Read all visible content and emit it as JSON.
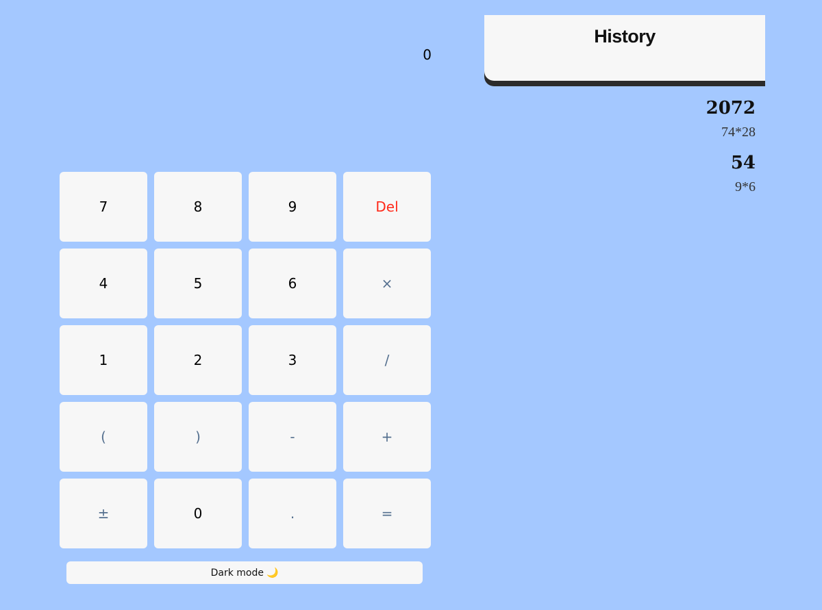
{
  "display": {
    "value": "0"
  },
  "keypad": {
    "keys": [
      {
        "label": "7",
        "role": "digit"
      },
      {
        "label": "8",
        "role": "digit"
      },
      {
        "label": "9",
        "role": "digit"
      },
      {
        "label": "Del",
        "role": "delete"
      },
      {
        "label": "4",
        "role": "digit"
      },
      {
        "label": "5",
        "role": "digit"
      },
      {
        "label": "6",
        "role": "digit"
      },
      {
        "label": "×",
        "role": "operator"
      },
      {
        "label": "1",
        "role": "digit"
      },
      {
        "label": "2",
        "role": "digit"
      },
      {
        "label": "3",
        "role": "digit"
      },
      {
        "label": "/",
        "role": "operator"
      },
      {
        "label": "(",
        "role": "operator"
      },
      {
        "label": ")",
        "role": "operator"
      },
      {
        "label": "-",
        "role": "operator"
      },
      {
        "label": "+",
        "role": "operator"
      },
      {
        "label": "±",
        "role": "operator"
      },
      {
        "label": "0",
        "role": "digit"
      },
      {
        "label": ".",
        "role": "operator"
      },
      {
        "label": "=",
        "role": "operator"
      }
    ]
  },
  "dark_mode": {
    "label": "Dark mode",
    "icon": "🌙",
    "icon_name": "moon-icon"
  },
  "history": {
    "title": "History",
    "entries": [
      {
        "result": "2072",
        "expression": "74*28"
      },
      {
        "result": "54",
        "expression": "9*6"
      }
    ]
  },
  "colors": {
    "background": "#a4c8ff",
    "key_background": "#f7f7f7",
    "operator_text": "#55708f",
    "delete_text": "#ff2a1a"
  }
}
